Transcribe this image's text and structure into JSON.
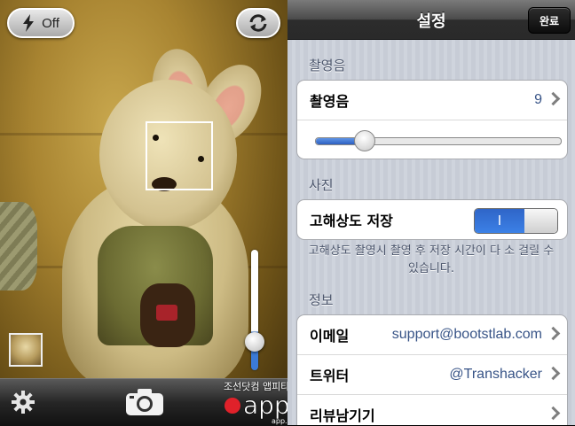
{
  "camera": {
    "flash_label": "Off",
    "watermark_text": "조선닷컴 앱피타이저",
    "watermark_logo": "appetizer",
    "watermark_sub": "app.chosun.com"
  },
  "settings": {
    "title": "설정",
    "done_label": "완료",
    "sections": {
      "sound_header": "촬영음",
      "photo_header": "사진",
      "info_header": "정보"
    },
    "sound_row": {
      "label": "촬영음",
      "value": "9"
    },
    "volume_slider": {
      "fraction": 0.2
    },
    "hires_row": {
      "label": "고해상도 저장",
      "toggle_text": "I",
      "enabled": true
    },
    "footer_note": "고해상도 촬영시 촬영 후 저장 시간이 다 소 걸릴 수 있습니다.",
    "info_rows": [
      {
        "label": "이메일",
        "value": "support@bootstlab.com"
      },
      {
        "label": "트위터",
        "value": "@Transhacker"
      },
      {
        "label": "리뷰남기기",
        "value": ""
      }
    ]
  },
  "zoom": {
    "fraction": 0.3
  },
  "colors": {
    "accent": "#3b7ad6",
    "nav": "#2c2c2c",
    "value_text": "#385487"
  },
  "icons": [
    "flash-icon",
    "switch-camera-icon",
    "gear-icon",
    "camera-icon",
    "chevron-right-icon"
  ]
}
